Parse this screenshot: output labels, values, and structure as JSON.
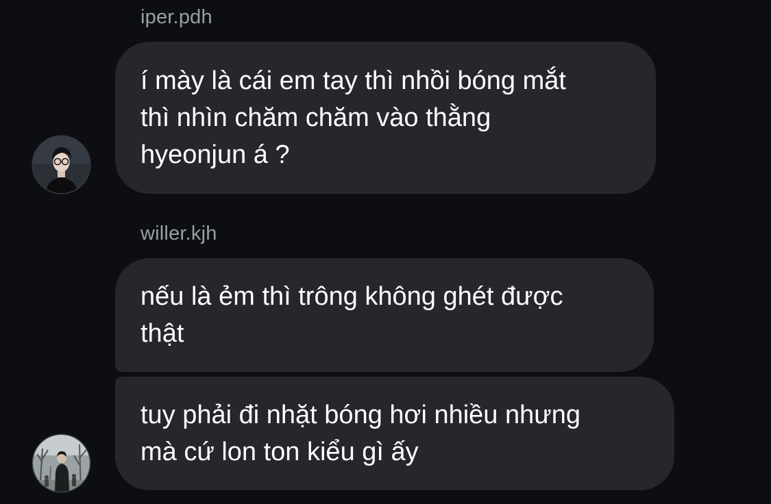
{
  "messages": [
    {
      "sender": "iper.pdh",
      "bubbles": [
        "í mày là cái em tay thì nhồi bóng mắt\nthì nhìn chăm chăm vào thằng\nhyeonjun á ?"
      ]
    },
    {
      "sender": "willer.kjh",
      "bubbles": [
        "nếu là ẻm thì trông không ghét được\nthật",
        "tuy phải đi nhặt bóng hơi nhiều nhưng\nmà cứ lon ton kiểu gì ấy"
      ]
    }
  ],
  "colors": {
    "background": "#0c0e11",
    "bubble": "#25272c",
    "sender_text": "#9a9ea6",
    "message_text": "#ffffff"
  },
  "icons": {
    "avatar_1": "user-avatar-photo",
    "avatar_2": "user-avatar-photo"
  }
}
